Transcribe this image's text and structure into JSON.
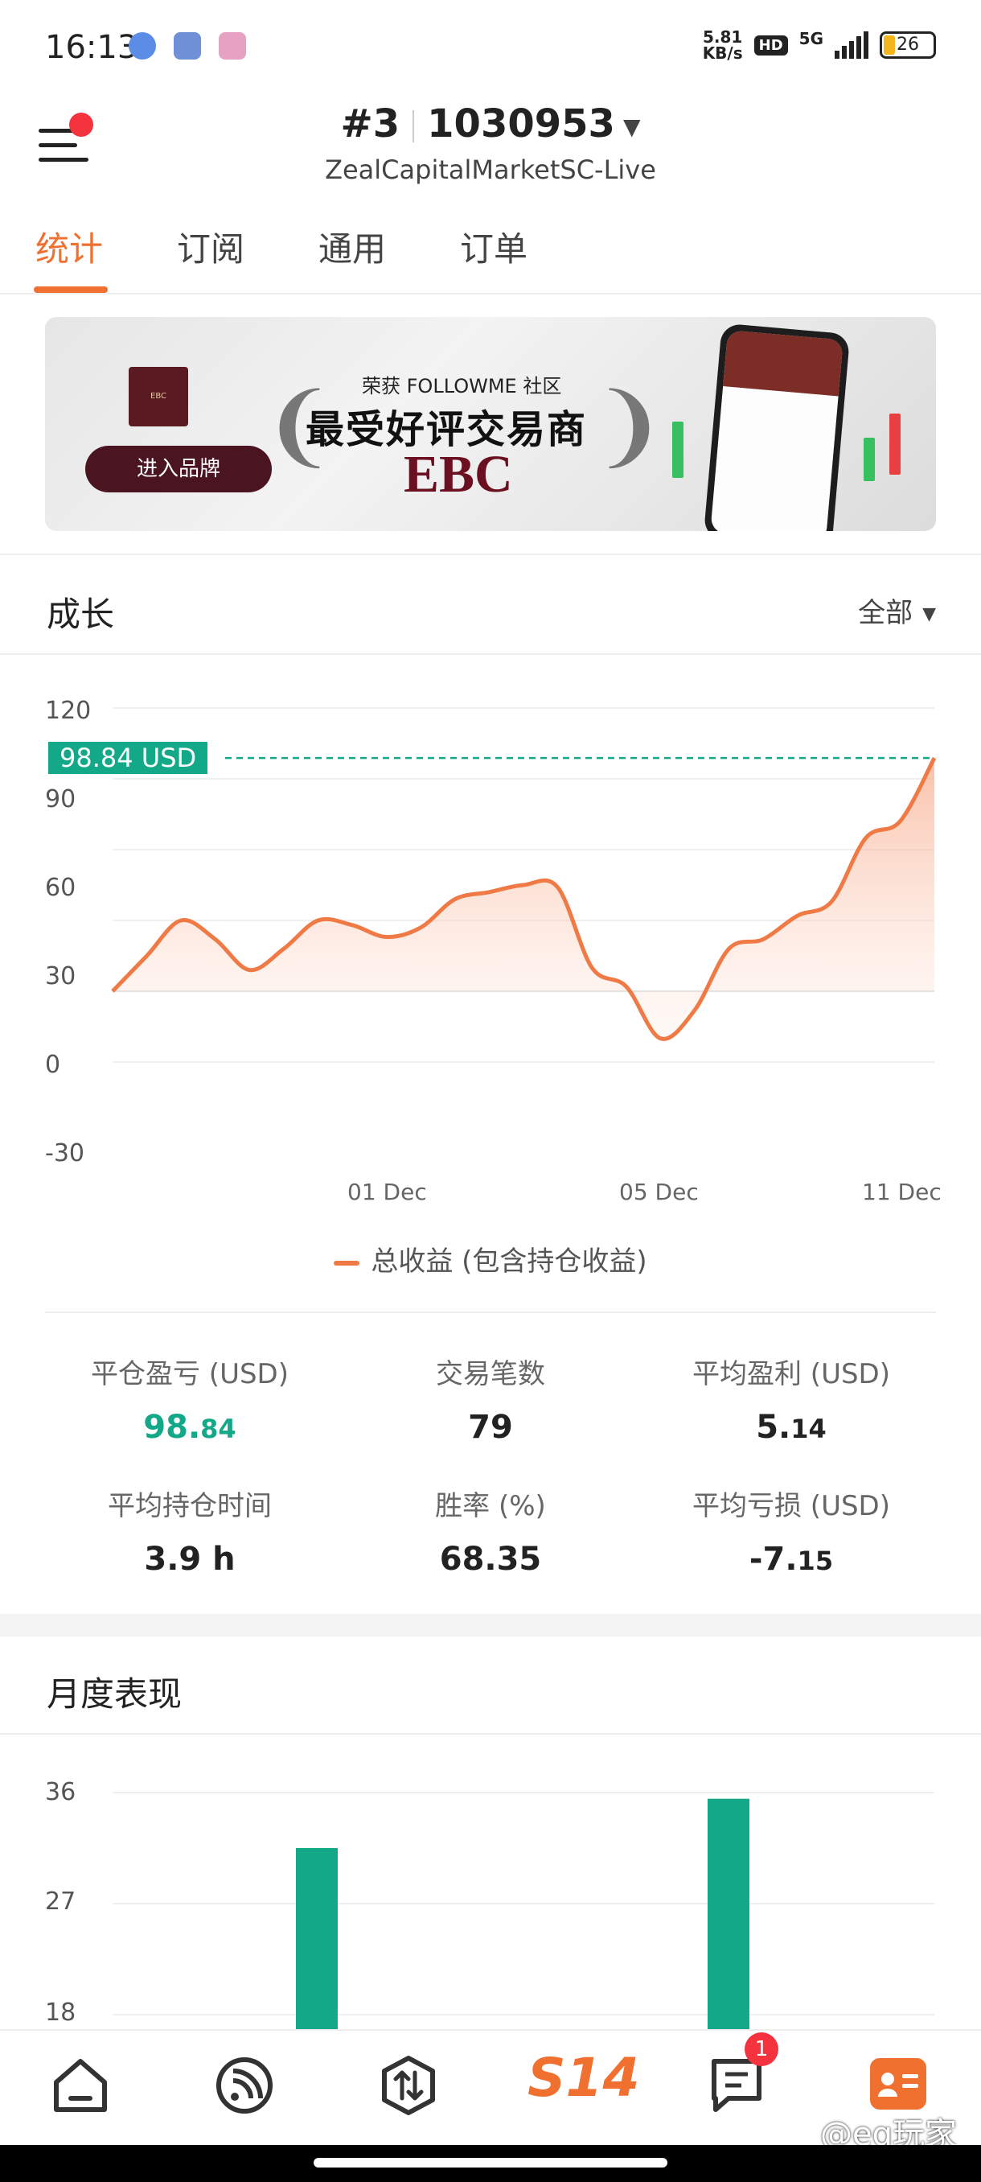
{
  "status_bar": {
    "time": "16:13",
    "net_speed": "5.81",
    "net_unit": "KB/s",
    "hd": "HD",
    "network": "5G",
    "battery": "26"
  },
  "header": {
    "account_rank": "#3",
    "account_id": "1030953",
    "server": "ZealCapitalMarketSC-Live"
  },
  "tabs": [
    "统计",
    "订阅",
    "通用",
    "订单"
  ],
  "banner": {
    "enter_label": "进入品牌",
    "small_text": "荣获 FOLLOWME 社区",
    "headline": "最受好评交易商",
    "brand": "EBC"
  },
  "growth": {
    "title": "成长",
    "filter": "全部",
    "current_label": "98.84 USD",
    "legend": "总收益 (包含持仓收益)"
  },
  "chart_data": [
    {
      "type": "area",
      "title": "",
      "xlabel": "",
      "ylabel": "",
      "ylim": [
        -30,
        120
      ],
      "yticks": [
        120,
        90,
        60,
        30,
        0,
        -30
      ],
      "xtick_labels": [
        "01 Dec",
        "05 Dec",
        "11 Dec"
      ],
      "series": [
        {
          "name": "总收益 (包含持仓收益)",
          "color": "#f07a45",
          "values": [
            0,
            15,
            30,
            22,
            9,
            18,
            30,
            28,
            23,
            27,
            39,
            42,
            45,
            44,
            10,
            2,
            -20,
            -8,
            18,
            22,
            32,
            38,
            65,
            72,
            98.84
          ]
        }
      ],
      "reference_line": {
        "value": 98.84,
        "color": "#13a887",
        "label": "98.84 USD"
      },
      "grid": true
    },
    {
      "type": "bar",
      "title": "",
      "ylim": [
        18,
        36
      ],
      "yticks": [
        36,
        27,
        18
      ],
      "series": [
        {
          "name": "",
          "color": "#13a887",
          "values": [
            31.5,
            35.5
          ]
        }
      ],
      "grid": true
    }
  ],
  "stats": [
    {
      "label": "平仓盈亏 (USD)",
      "int": "98.",
      "dec": "84",
      "accent": "green"
    },
    {
      "label": "交易笔数",
      "int": "79",
      "dec": "",
      "accent": "none"
    },
    {
      "label": "平均盈利 (USD)",
      "int": "5.",
      "dec": "14",
      "accent": "none"
    },
    {
      "label": "平均持仓时间",
      "int": "3.9 h",
      "dec": "",
      "accent": "none"
    },
    {
      "label": "胜率 (%)",
      "int": "68.35",
      "dec": "",
      "accent": "none"
    },
    {
      "label": "平均亏损 (USD)",
      "int": "-7.",
      "dec": "15",
      "accent": "none"
    }
  ],
  "monthly": {
    "title": "月度表现"
  },
  "bottom_nav": {
    "s14_label": "S14",
    "messages_badge": "1"
  },
  "watermark": "@eq玩家",
  "colors": {
    "accent": "#f07030",
    "green": "#13a887",
    "line": "#f07a45"
  }
}
